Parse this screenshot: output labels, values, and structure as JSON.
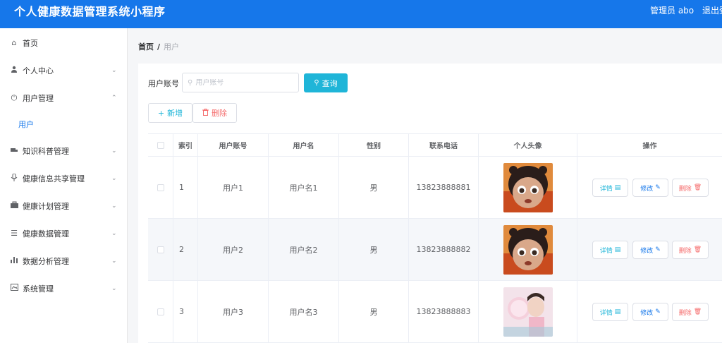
{
  "header": {
    "title": "个人健康数据管理系统小程序",
    "admin_label": "管理员 abo",
    "logout_label": "退出登录"
  },
  "sidebar": {
    "items": [
      {
        "label": "首页",
        "icon": "home-icon"
      },
      {
        "label": "个人中心",
        "icon": "user-icon"
      },
      {
        "label": "用户管理",
        "icon": "power-icon"
      },
      {
        "label": "用户",
        "icon": ""
      },
      {
        "label": "知识科普管理",
        "icon": "truck-icon"
      },
      {
        "label": "健康信息共享管理",
        "icon": "mic-icon"
      },
      {
        "label": "健康计划管理",
        "icon": "briefcase-icon"
      },
      {
        "label": "健康数据管理",
        "icon": "list-icon"
      },
      {
        "label": "数据分析管理",
        "icon": "bar-chart-icon"
      },
      {
        "label": "系统管理",
        "icon": "image-icon"
      }
    ]
  },
  "breadcrumb": {
    "home": "首页",
    "separator": "/",
    "current": "用户"
  },
  "search": {
    "label": "用户账号",
    "placeholder": "用户账号",
    "button_label": "查询"
  },
  "actions": {
    "add_label": "新增",
    "delete_label": "删除"
  },
  "table": {
    "columns": [
      "索引",
      "用户账号",
      "用户名",
      "性别",
      "联系电话",
      "个人头像",
      "操作"
    ],
    "rows": [
      {
        "index": "1",
        "account": "用户1",
        "name": "用户名1",
        "gender": "男",
        "phone": "13823888881"
      },
      {
        "index": "2",
        "account": "用户2",
        "name": "用户名2",
        "gender": "男",
        "phone": "13823888882"
      },
      {
        "index": "3",
        "account": "用户3",
        "name": "用户名3",
        "gender": "男",
        "phone": "13823888883"
      }
    ],
    "ops": {
      "detail": "详情",
      "edit": "修改",
      "delete": "删除"
    }
  },
  "colors": {
    "header_bg": "#1677ea",
    "accent_cyan": "#1fb5d8",
    "danger": "#f56c6c"
  }
}
